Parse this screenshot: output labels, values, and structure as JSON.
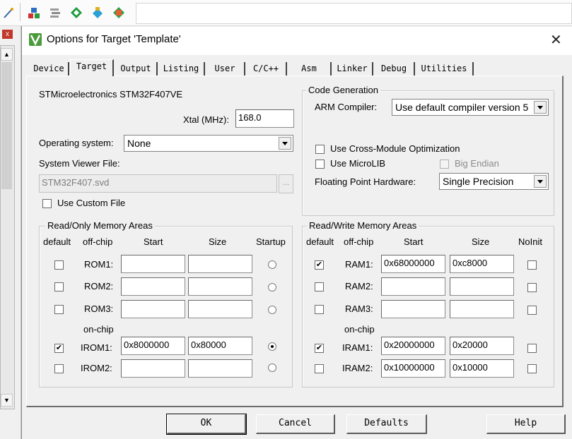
{
  "dialog": {
    "title": "Options for Target 'Template'",
    "close_glyph": "✕"
  },
  "tabs": [
    {
      "label": "Device"
    },
    {
      "label": "Target"
    },
    {
      "label": "Output"
    },
    {
      "label": "Listing"
    },
    {
      "label": "User"
    },
    {
      "label": "C/C++"
    },
    {
      "label": "Asm"
    },
    {
      "label": "Linker"
    },
    {
      "label": "Debug"
    },
    {
      "label": "Utilities"
    }
  ],
  "target": {
    "device_name": "STMicroelectronics STM32F407VE",
    "xtal_label": "Xtal (MHz):",
    "xtal_value": "168.0",
    "os_label": "Operating system:",
    "os_value": "None",
    "svd_label": "System Viewer File:",
    "svd_value": "STM32F407.svd",
    "svd_browse": "...",
    "custom_file_label": "Use Custom File"
  },
  "codegen": {
    "legend": "Code Generation",
    "compiler_label": "ARM Compiler:",
    "compiler_value": "Use default compiler version 5",
    "cross_module_label": "Use Cross-Module Optimization",
    "microlib_label": "Use MicroLIB",
    "big_endian_label": "Big Endian",
    "fpu_label": "Floating Point Hardware:",
    "fpu_value": "Single Precision"
  },
  "ro_memory": {
    "legend": "Read/Only Memory Areas",
    "headers": {
      "default": "default",
      "offchip": "off-chip",
      "start": "Start",
      "size": "Size",
      "startup": "Startup"
    },
    "onchip_label": "on-chip",
    "rows": [
      {
        "label": "ROM1:",
        "start": "",
        "size": "",
        "checked": false,
        "startup": false
      },
      {
        "label": "ROM2:",
        "start": "",
        "size": "",
        "checked": false,
        "startup": false
      },
      {
        "label": "ROM3:",
        "start": "",
        "size": "",
        "checked": false,
        "startup": false
      },
      {
        "label": "IROM1:",
        "start": "0x8000000",
        "size": "0x80000",
        "checked": true,
        "startup": true
      },
      {
        "label": "IROM2:",
        "start": "",
        "size": "",
        "checked": false,
        "startup": false
      }
    ]
  },
  "rw_memory": {
    "legend": "Read/Write Memory Areas",
    "headers": {
      "default": "default",
      "offchip": "off-chip",
      "start": "Start",
      "size": "Size",
      "noinit": "NoInit"
    },
    "onchip_label": "on-chip",
    "rows": [
      {
        "label": "RAM1:",
        "start": "0x68000000",
        "size": "0xc8000",
        "checked": true
      },
      {
        "label": "RAM2:",
        "start": "",
        "size": "",
        "checked": false
      },
      {
        "label": "RAM3:",
        "start": "",
        "size": "",
        "checked": false
      },
      {
        "label": "IRAM1:",
        "start": "0x20000000",
        "size": "0x20000",
        "checked": true
      },
      {
        "label": "IRAM2:",
        "start": "0x10000000",
        "size": "0x10000",
        "checked": false
      }
    ]
  },
  "buttons": {
    "ok": "OK",
    "cancel": "Cancel",
    "defaults": "Defaults",
    "help": "Help"
  },
  "check_glyph": "✔"
}
